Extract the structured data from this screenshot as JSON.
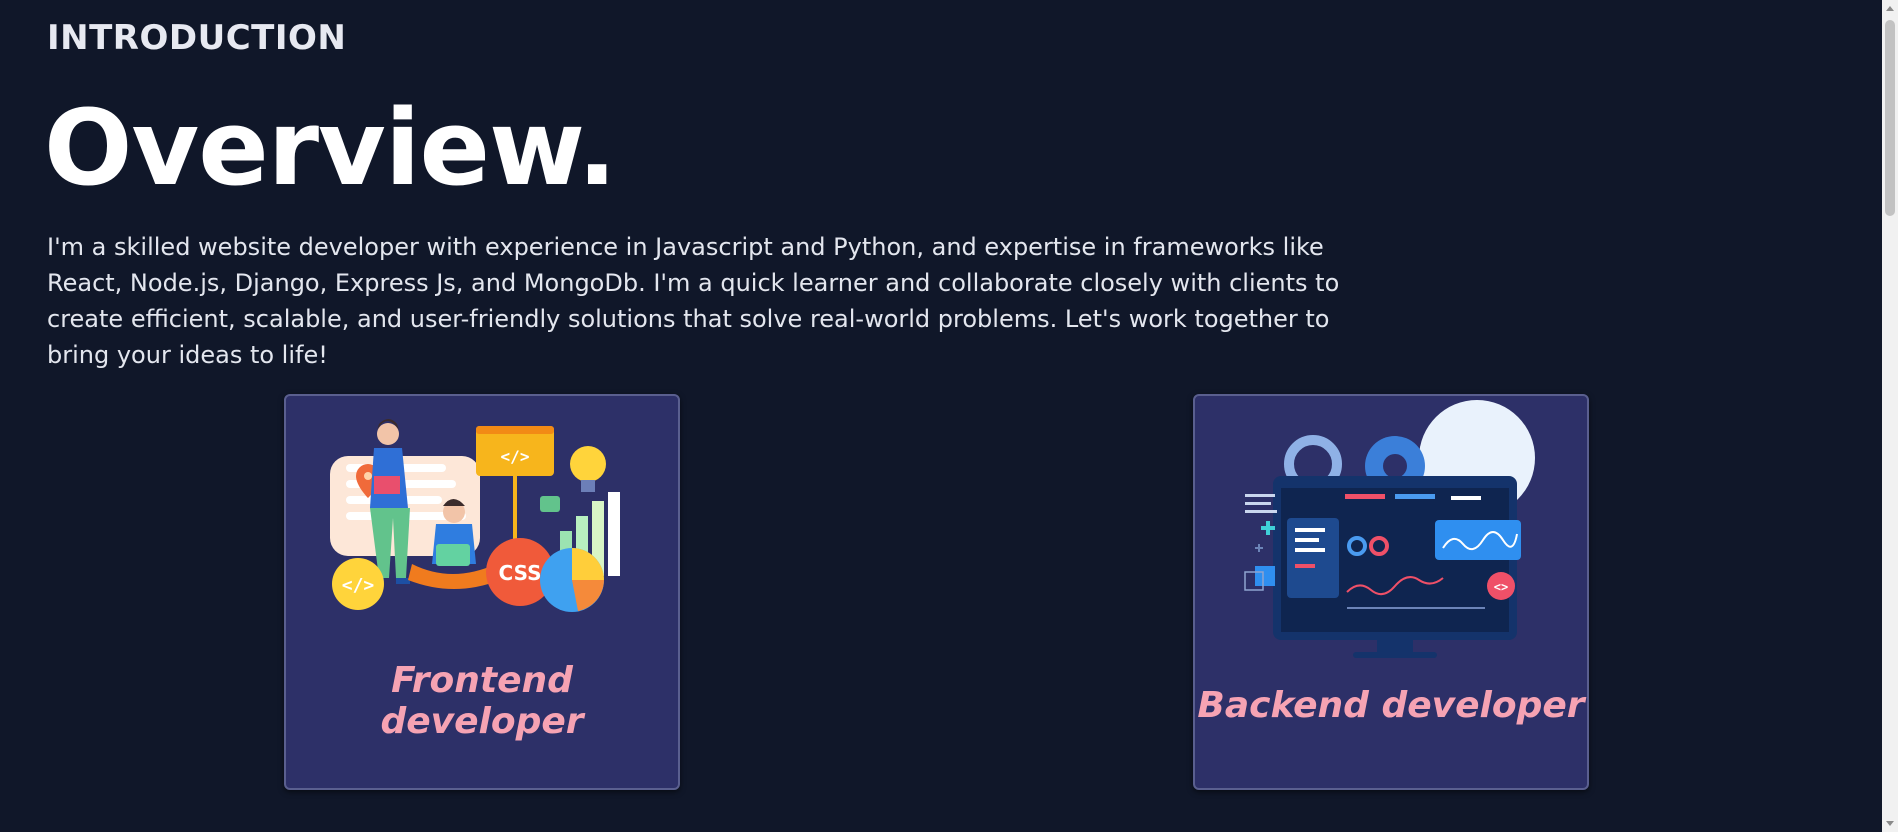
{
  "section": {
    "subtitle": "INTRODUCTION",
    "title": "Overview.",
    "description": "I'm a skilled website developer with experience in Javascript and Python, and expertise in frameworks like React, Node.js, Django, Express Js, and MongoDb. I'm a quick learner and collaborate closely with clients to create efficient, scalable, and user-friendly solutions that solve real-world problems. Let's work together to bring your ideas to life!"
  },
  "cards": [
    {
      "label": "Frontend developer",
      "icon": "frontend-developer-illustration",
      "css_badge": "CSS",
      "code_tag": "</>"
    },
    {
      "label": "Backend developer",
      "icon": "backend-developer-illustration",
      "code_badge": "<>"
    }
  ],
  "colors": {
    "background": "#101729",
    "card": "#2d3068",
    "card_label": "#f6a3b3",
    "text": "#e3e6ee"
  }
}
